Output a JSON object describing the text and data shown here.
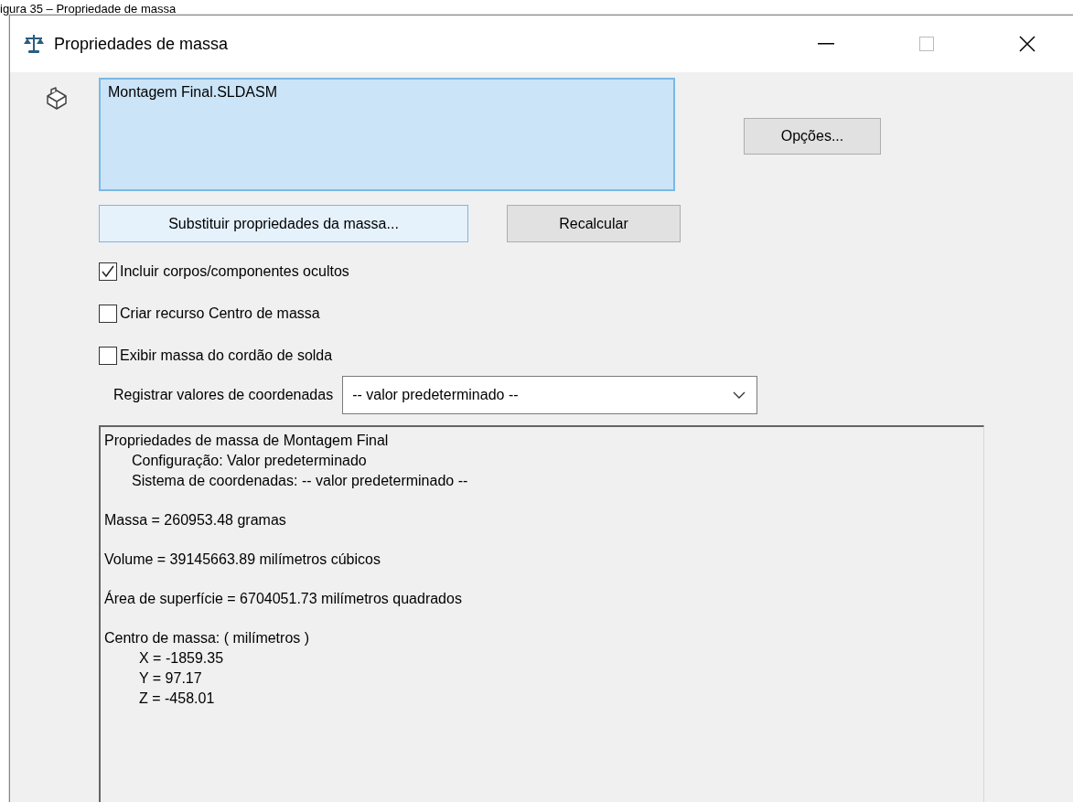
{
  "caption": "igura 35 – Propriedade de massa",
  "window": {
    "title": "Propriedades de massa"
  },
  "selection_box": {
    "items": [
      "Montagem Final.SLDASM"
    ]
  },
  "options_button": "Opções...",
  "override_button": "Substituir propriedades da massa...",
  "recalculate_button": "Recalcular",
  "checkboxes": [
    {
      "label": "Incluir corpos/componentes ocultos",
      "checked": true
    },
    {
      "label": "Criar recurso Centro de massa",
      "checked": false
    },
    {
      "label": "Exibir massa do cordão de solda",
      "checked": false
    }
  ],
  "coordinates": {
    "label": "Registrar valores de coordenadas",
    "value": "-- valor predeterminado --"
  },
  "results": [
    {
      "text": "Propriedades de massa de Montagem Final",
      "children": [
        {
          "text": "Configuração: Valor predeterminado"
        },
        {
          "text": "Sistema de coordenadas: -- valor predeterminado --"
        }
      ]
    },
    {
      "text": "Massa = 260953.48 gramas"
    },
    {
      "text": "Volume = 39145663.89 milímetros cúbicos"
    },
    {
      "text": "Área de superfície = 6704051.73  milímetros quadrados"
    },
    {
      "text": "Centro de massa: ( milímetros )",
      "children": [
        {
          "text": "X = -1859.35"
        },
        {
          "text": "Y = 97.17"
        },
        {
          "text": "Z = -458.01"
        }
      ]
    }
  ]
}
